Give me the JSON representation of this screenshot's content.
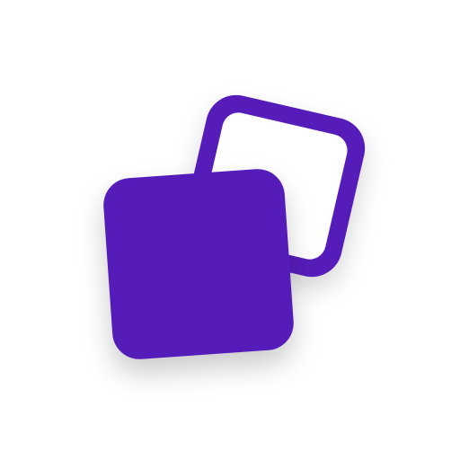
{
  "icon": {
    "name": "overlapping-squares-icon",
    "colors": {
      "accent": "#571EBA",
      "background": "#FFFFFF",
      "inner_fill": "#FFFFFF"
    }
  }
}
